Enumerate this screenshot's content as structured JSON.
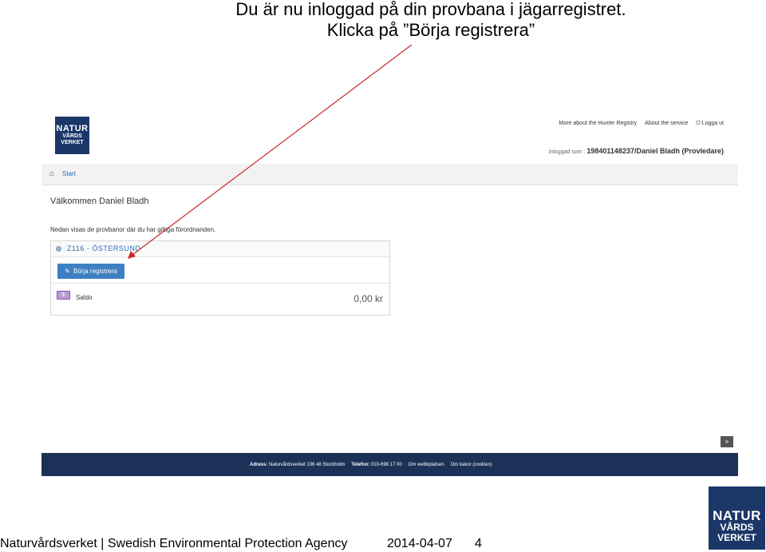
{
  "slide": {
    "title_line1": "Du är nu inloggad på din provbana i jägarregistret.",
    "title_line2": "Klicka på ”Börja registrera”"
  },
  "logo": {
    "line1": "NATUR",
    "line2": "VÅRDS",
    "line3": "VERKET"
  },
  "header": {
    "links": [
      "More about the Hunter Registry",
      "About the service",
      "Logga ut"
    ],
    "logged_in_label": "Inloggad som :",
    "logged_in_user": "198401148237/Daniel Bladh (Provledare)"
  },
  "nav": {
    "home_icon": "home-icon",
    "start_label": "Start"
  },
  "main": {
    "welcome": "Välkommen Daniel Bladh",
    "intro": "Nedan visas de provbanor där du har giltiga förordnanden.",
    "area_name": "Z116 - ÖSTERSUND",
    "register_button": "Börja registrera",
    "saldo_label": "Saldo",
    "saldo_value": "0,00 kr"
  },
  "footer": {
    "address_label": "Adress:",
    "address_value": "Naturvårdsverket 106 48 Stockholm",
    "phone_label": "Telefon:",
    "phone_value": "010-698 17 00",
    "link_about": "Om webbplatsen",
    "link_cookies": "Om kakor (cookies)"
  },
  "bottom": {
    "org": "Naturvårdsverket | Swedish Environmental Protection Agency",
    "date": "2014-04-07",
    "page": "4"
  },
  "colors": {
    "brand_blue": "#1b3768",
    "footer_blue": "#1c3158",
    "button_blue": "#3d7fc2",
    "arrow_red": "#c62828"
  }
}
